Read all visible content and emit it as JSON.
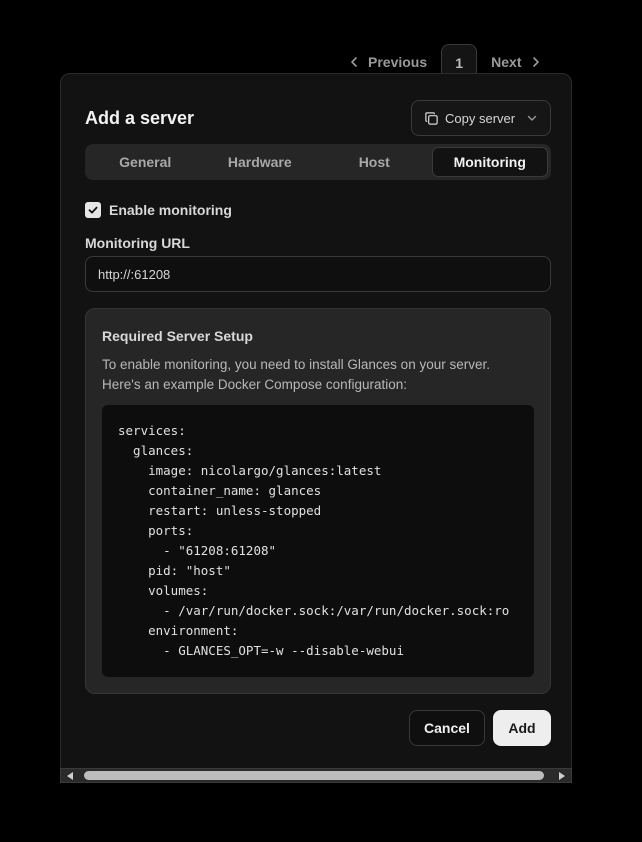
{
  "pagination": {
    "previous_label": "Previous",
    "current_page": "1",
    "next_label": "Next"
  },
  "dialog": {
    "title": "Add a server",
    "copy_server_label": "Copy server"
  },
  "tabs": [
    {
      "label": "General",
      "active": false
    },
    {
      "label": "Hardware",
      "active": false
    },
    {
      "label": "Host",
      "active": false
    },
    {
      "label": "Monitoring",
      "active": true
    }
  ],
  "monitoring": {
    "enable_label": "Enable monitoring",
    "enabled": true,
    "url_label": "Monitoring URL",
    "url_value": "http://:61208"
  },
  "setup": {
    "title": "Required Server Setup",
    "description": "To enable monitoring, you need to install Glances on your server. Here's an example Docker Compose configuration:",
    "code": "services:\n  glances:\n    image: nicolargo/glances:latest\n    container_name: glances\n    restart: unless-stopped\n    ports:\n      - \"61208:61208\"\n    pid: \"host\"\n    volumes:\n      - /var/run/docker.sock:/var/run/docker.sock:ro\n    environment:\n      - GLANCES_OPT=-w --disable-webui"
  },
  "footer": {
    "cancel_label": "Cancel",
    "add_label": "Add"
  },
  "icons": {
    "previous": "chevron-left-icon",
    "next": "chevron-right-icon",
    "copy": "copy-icon",
    "dropdown": "chevron-down-icon",
    "checkbox": "check-icon"
  }
}
